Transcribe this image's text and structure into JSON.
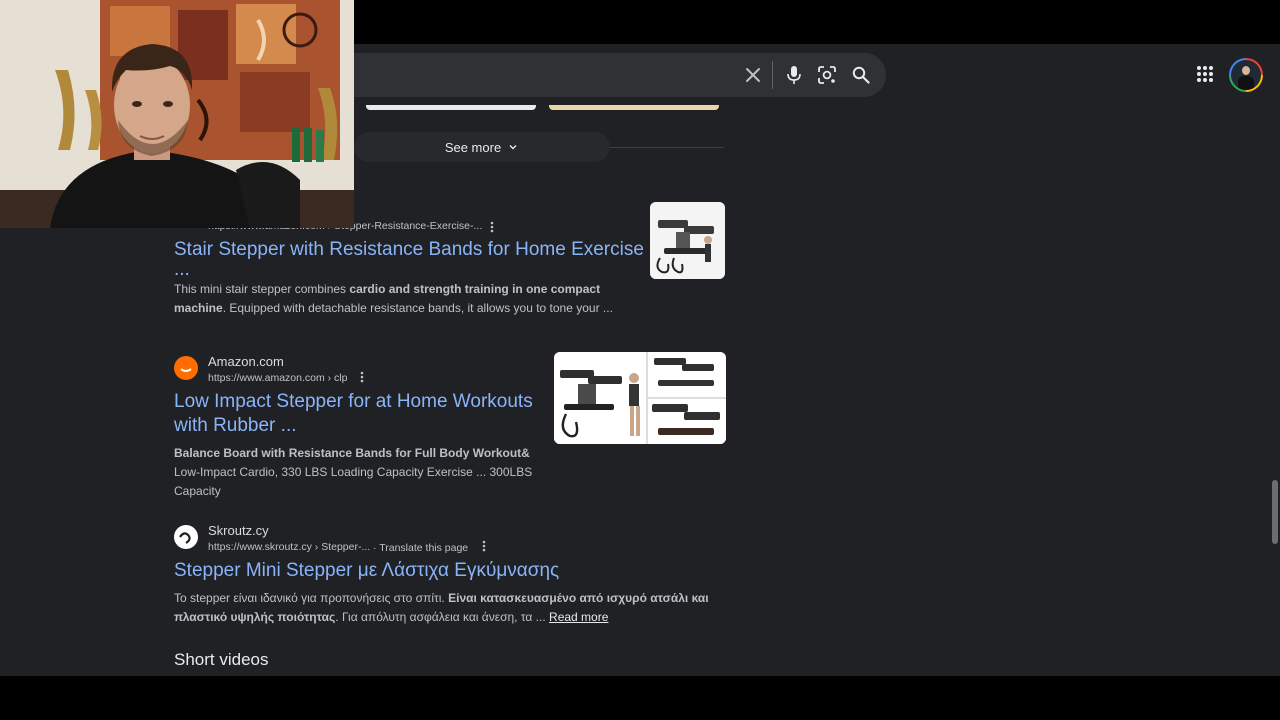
{
  "search": {
    "placeholder": ""
  },
  "see_more_label": "See more",
  "results": [
    {
      "site_name": "",
      "url": "https://www.amazon.com › Stepper-Resistance-Exercise-...",
      "title_line1": "Stair Stepper with Resistance Bands for Home Exercise",
      "title_line2": "...",
      "snippet_pre": "This mini stair stepper combines ",
      "snippet_bold": "cardio and strength training in one compact machine",
      "snippet_post": ". Equipped with detachable resistance bands, it allows you to tone your ..."
    },
    {
      "site_name": "Amazon.com",
      "url": "https://www.amazon.com › clp",
      "title_line1": "Low Impact Stepper for at Home Workouts",
      "title_line2": "with Rubber ...",
      "snippet_bold": "Balance Board with Resistance Bands for Full Body Workout&",
      "snippet_line2": "Low-Impact Cardio, 330 LBS Loading Capacity Exercise ... 300LBS",
      "snippet_line3": "Capacity"
    },
    {
      "site_name": "Skroutz.cy",
      "url": "https://www.skroutz.cy › Stepper-...",
      "translate_label": "· Translate this page",
      "title": "Stepper Mini Stepper με Λάστιχα Εγκύμνασης",
      "snippet_pre": "Το stepper είναι ιδανικό για προπονήσεις στο σπίτι. ",
      "snippet_bold": "Είναι κατασκευασμένο από ισχυρό ατσάλι και πλαστικό υψηλής ποιότητας",
      "snippet_post": ". Για απόλυτη ασφάλεια και άνεση, τα ... ",
      "read_more": "Read more"
    }
  ],
  "short_videos_heading": "Short videos",
  "icons": {
    "clear": "close-icon",
    "voice": "microphone-icon",
    "lens": "camera-lens-icon",
    "search": "search-icon",
    "apps": "apps-grid-icon",
    "more": "more-vert-icon",
    "see_more_chevron": "chevron-down-icon"
  },
  "colors": {
    "page_bg": "#202124",
    "link": "#8ab4f8",
    "amazon_orange": "#ff6d00"
  }
}
